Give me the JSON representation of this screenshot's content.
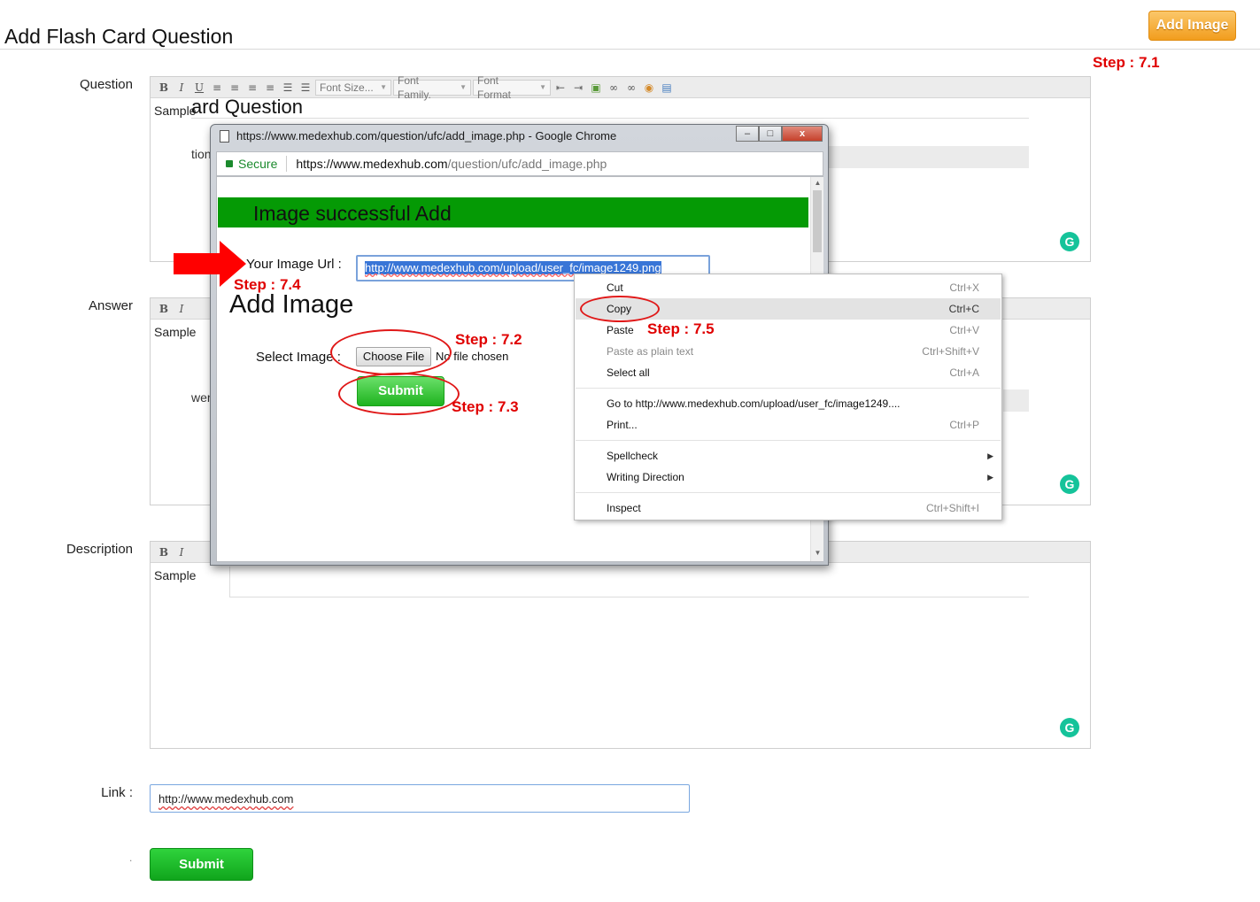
{
  "page": {
    "title": "Add Flash Card Question",
    "add_image_button": "Add Image"
  },
  "steps": {
    "s71": "Step : 7.1",
    "s72": "Step : 7.2",
    "s73": "Step : 7.3",
    "s74": "Step : 7.4",
    "s75": "Step : 7.5"
  },
  "form": {
    "question_label": "Question",
    "answer_label": "Answer",
    "description_label": "Description",
    "link_label": "Link :",
    "link_value": "http://www.medexhub.com",
    "sample_text": "Sample",
    "question_ghost_heading": "ard Question",
    "question_ghost_fragment": "tion",
    "answer_ghost_fragment": "wer",
    "submit_label": "Submit",
    "dot": "."
  },
  "toolbar": {
    "bold": "B",
    "italic": "I",
    "underline": "U",
    "font_size": "Font Size...",
    "font_family": "Font Family.",
    "font_format": "Font Format"
  },
  "popup": {
    "window_title": "https://www.medexhub.com/question/ufc/add_image.php - Google Chrome",
    "secure": "Secure",
    "url_host": "https://www.medexhub.com",
    "url_path": "/question/ufc/add_image.php",
    "success_message": "Image successful Add",
    "image_url_label": "Your Image Url :",
    "image_url_value": "http://www.medexhub.com/upload/user_fc/image1249.png",
    "add_image_heading": "Add Image",
    "select_image_label": "Select Image :",
    "choose_file": "Choose File",
    "no_file": "No file chosen",
    "submit": "Submit"
  },
  "context_menu": {
    "items": [
      {
        "label": "Cut",
        "shortcut": "Ctrl+X"
      },
      {
        "label": "Copy",
        "shortcut": "Ctrl+C"
      },
      {
        "label": "Paste",
        "shortcut": "Ctrl+V"
      },
      {
        "label": "Paste as plain text",
        "shortcut": "Ctrl+Shift+V"
      },
      {
        "label": "Select all",
        "shortcut": "Ctrl+A"
      },
      {
        "label": "Go to http://www.medexhub.com/upload/user_fc/image1249....",
        "shortcut": ""
      },
      {
        "label": "Print...",
        "shortcut": "Ctrl+P"
      },
      {
        "label": "Spellcheck",
        "shortcut": ""
      },
      {
        "label": "Writing Direction",
        "shortcut": ""
      },
      {
        "label": "Inspect",
        "shortcut": "Ctrl+Shift+I"
      }
    ]
  },
  "icons": {
    "grammarly": "G",
    "minimize": "–",
    "maximize": "□",
    "close": "x",
    "submenu_arrow": "▶"
  },
  "colors": {
    "accent_orange": "#f29d1d",
    "success_green": "#059a05",
    "button_green": "#10a51c",
    "annotation_red": "#e00000"
  }
}
